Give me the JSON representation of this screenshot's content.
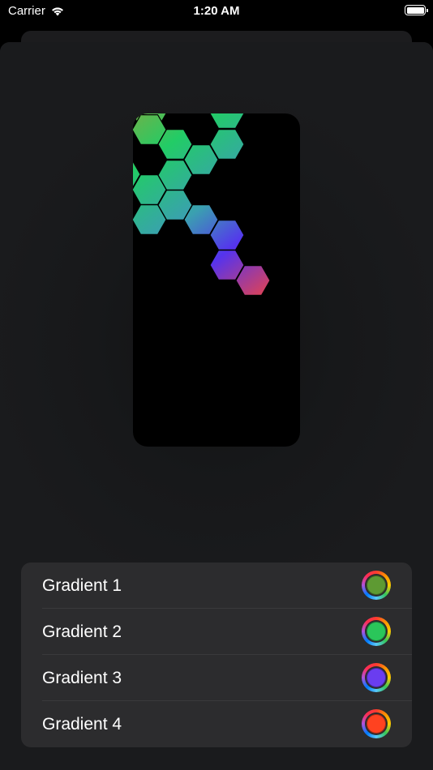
{
  "status_bar": {
    "carrier": "Carrier",
    "time": "1:20 AM"
  },
  "icons": {
    "wifi": "wifi-icon",
    "battery": "battery-icon",
    "color_well": "color-wheel-icon",
    "cell": "hexagon-cell"
  },
  "preview": {
    "gradient_colors": [
      "#6ab34a",
      "#22cc66",
      "#3aa0b0",
      "#5533ee",
      "#ee4444"
    ],
    "cell_outline": "#000000"
  },
  "gradients": [
    {
      "label": "Gradient 1",
      "color": "#5e9a33"
    },
    {
      "label": "Gradient 2",
      "color": "#2ac65a"
    },
    {
      "label": "Gradient 3",
      "color": "#6a3df0"
    },
    {
      "label": "Gradient 4",
      "color": "#ff4220"
    }
  ]
}
